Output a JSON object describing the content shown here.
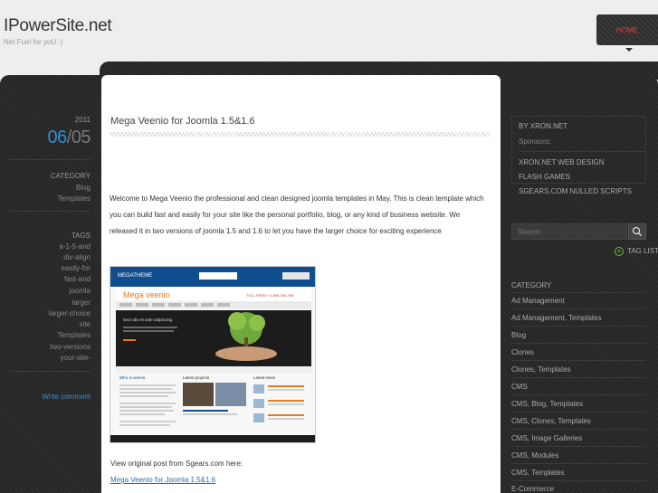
{
  "header": {
    "site_title": "IPowerSite.net",
    "tagline": "Net Fuel for yoU :)",
    "home_label": "HOME"
  },
  "left": {
    "year": "2011",
    "month": "06",
    "day": "/05",
    "category_label": "CATEGORY",
    "categories": [
      "Blog",
      "Templates"
    ],
    "tags_label": "TAGS",
    "tags": [
      "a-1-5-and",
      "div-align",
      "easily-for",
      "fast-and",
      "joomla",
      "larger",
      "larger-choice",
      "site",
      "Templates",
      "two-versions",
      "your-site-"
    ],
    "write_comment": "Write comment"
  },
  "post": {
    "title": "Mega Veenio for Joomla 1.5&1.6",
    "body": "Welcome to Mega Veenio the professional and clean designed joomla templates in May. This is clean template which you can build fast and easily for your site like the personal portfolio, blog, or any kind of business website. We released it in two versions of joomla 1.5 and 1.6 to let you have the larger choice for exciting experience",
    "view_original": "View original post from Sgears.com here:",
    "original_link": "Mega Veenio for Joomla 1.5&1.6",
    "screenshot": {
      "brand": "MEGATHEME",
      "site_name": "Mega veenio",
      "phone": "TOLL FREE! +1-800-400-708",
      "slide_text": "Sed odio et ante adipiscing",
      "col1": "Who is veenio",
      "col2": "Latest projects",
      "col3": "Latest news"
    }
  },
  "right": {
    "by_label": "BY XRON.NET",
    "sponsors_label": "Sponsors:",
    "sponsor_links": [
      "XRON.NET WEB DESIGN",
      "FLASH GAMES",
      "SGEARS.COM NULLED SCRIPTS"
    ],
    "search_placeholder": "Search",
    "tag_list": "TAG LIST",
    "category_label": "CATEGORY",
    "categories": [
      "Ad Management",
      "Ad Management, Templates",
      "Blog",
      "Clones",
      "Clones, Templates",
      "CMS",
      "CMS, Blog, Templates",
      "CMS, Clones, Templates",
      "CMS, Image Galleries",
      "CMS, Modules",
      "CMS, Templates",
      "E-Commerce"
    ]
  },
  "colors": {
    "accent_blue": "#2d8fd8",
    "home_red": "#e0413a",
    "tag_plus_green": "#6cbe3f"
  }
}
